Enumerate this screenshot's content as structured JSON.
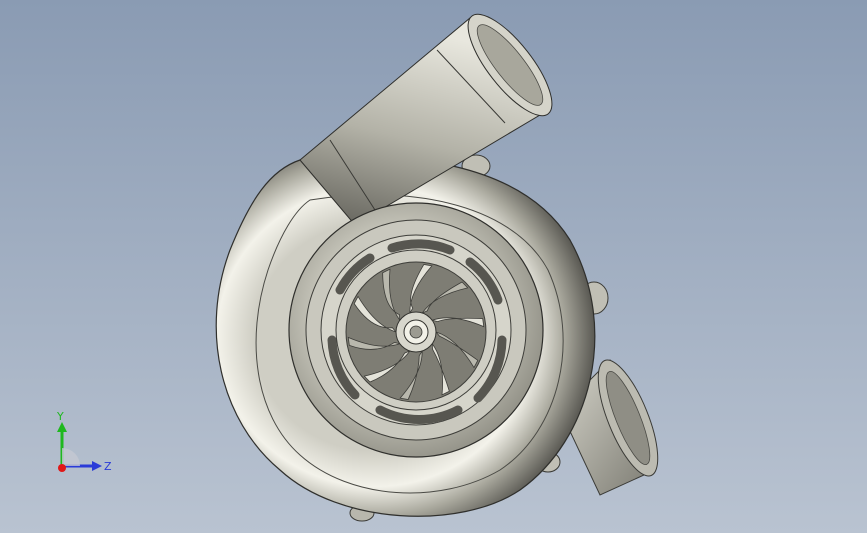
{
  "viewport": {
    "background_top": "#8a9bb3",
    "background_bottom": "#b9c3d1"
  },
  "model": {
    "name": "turbocharger-compressor-housing",
    "impeller_blade_count": 10,
    "metal_color": "#c7c6bc"
  },
  "triad": {
    "y_label": "Y",
    "z_label": "Z",
    "y_color": "#1fb81f",
    "z_color": "#2a3bd8",
    "x_color": "#e01818"
  }
}
